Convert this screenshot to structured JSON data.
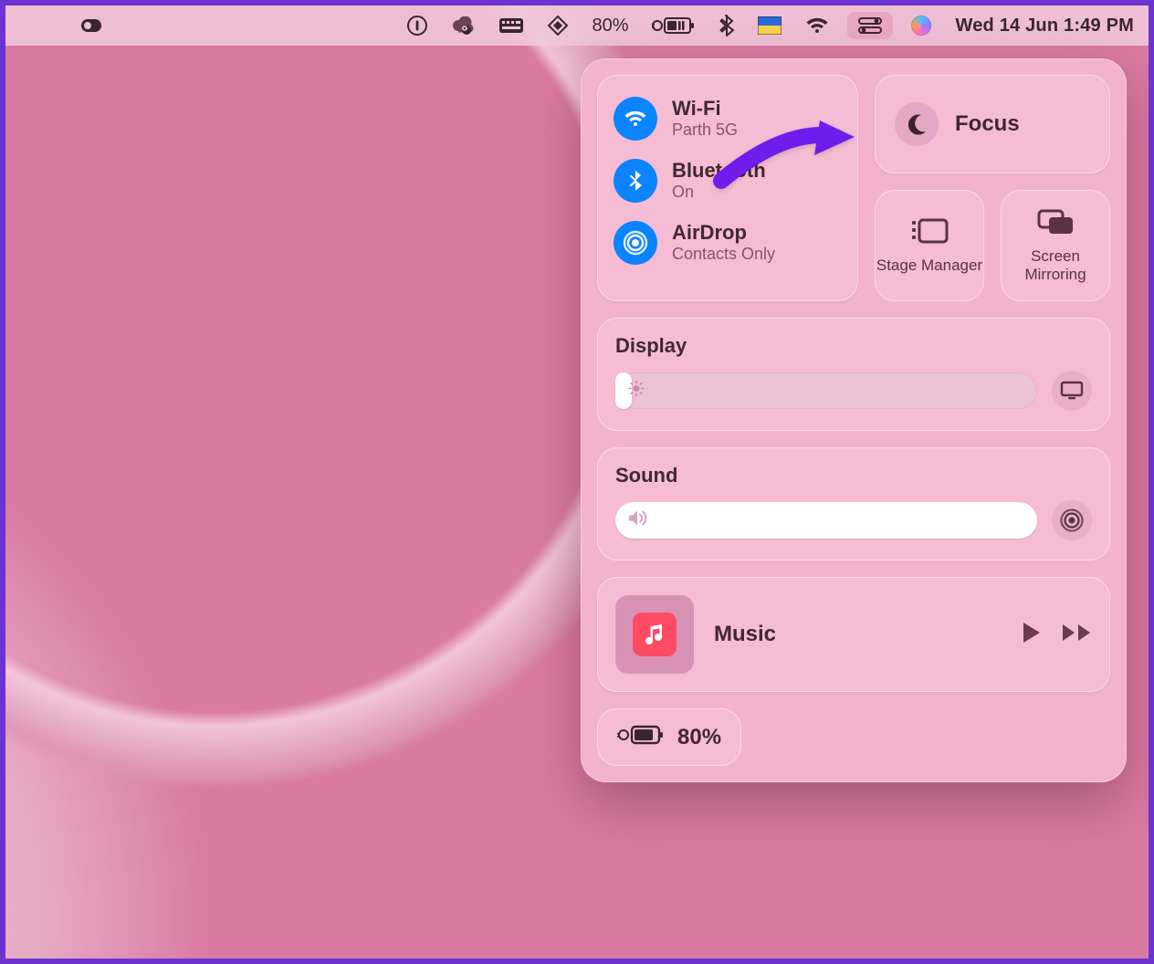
{
  "menubar": {
    "battery_pct": "80%",
    "date_time": "Wed 14 Jun  1:49 PM"
  },
  "control_center": {
    "wifi": {
      "title": "Wi-Fi",
      "sub": "Parth 5G"
    },
    "bluetooth": {
      "title": "Bluetooth",
      "sub": "On"
    },
    "airdrop": {
      "title": "AirDrop",
      "sub": "Contacts Only"
    },
    "focus": {
      "title": "Focus"
    },
    "stage_manager": {
      "label": "Stage Manager"
    },
    "screen_mirroring": {
      "label": "Screen Mirroring"
    },
    "display": {
      "title": "Display",
      "value_pct": 4
    },
    "sound": {
      "title": "Sound",
      "value_pct": 100
    },
    "now_playing": {
      "title": "Music"
    },
    "battery": {
      "pct": "80%"
    }
  }
}
